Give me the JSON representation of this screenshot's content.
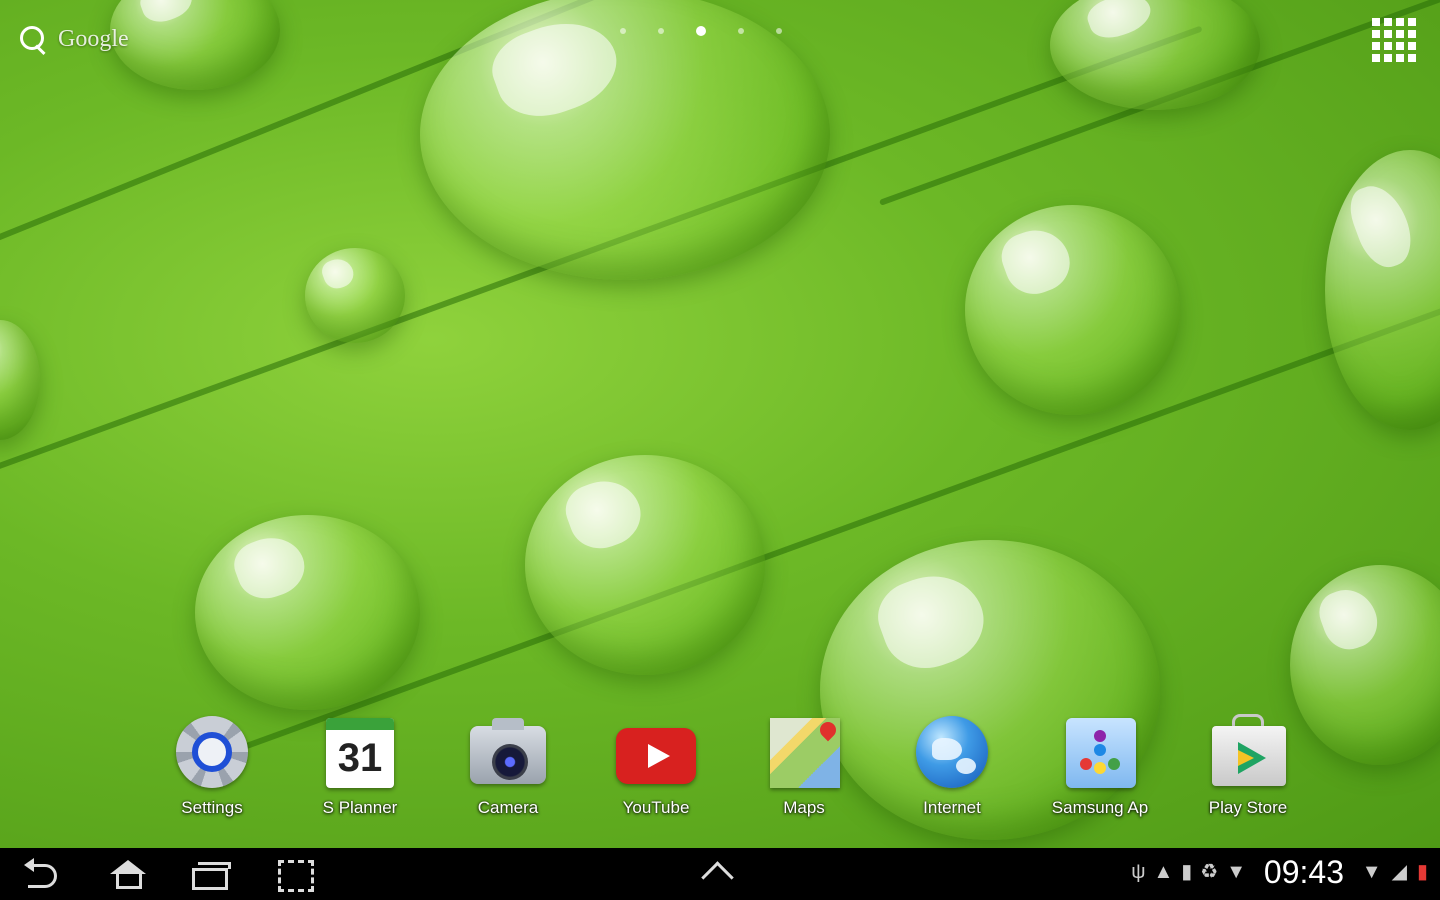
{
  "search": {
    "label": "Google"
  },
  "dock": {
    "apps": [
      {
        "label": "Settings"
      },
      {
        "label": "S Planner",
        "date": "31"
      },
      {
        "label": "Camera"
      },
      {
        "label": "YouTube"
      },
      {
        "label": "Maps"
      },
      {
        "label": "Internet"
      },
      {
        "label": "Samsung Ap"
      },
      {
        "label": "Play Store"
      }
    ]
  },
  "status": {
    "time": "09:43",
    "icons": [
      "usb-icon",
      "warning-icon",
      "sd-card-icon",
      "sync-icon",
      "wifi-icon",
      "signal-icon",
      "battery-icon"
    ]
  },
  "navbar": {
    "buttons": [
      "back-button",
      "home-button",
      "recent-apps-button",
      "screenshot-button"
    ]
  },
  "home": {
    "page_count": 5,
    "active_page": 3
  }
}
